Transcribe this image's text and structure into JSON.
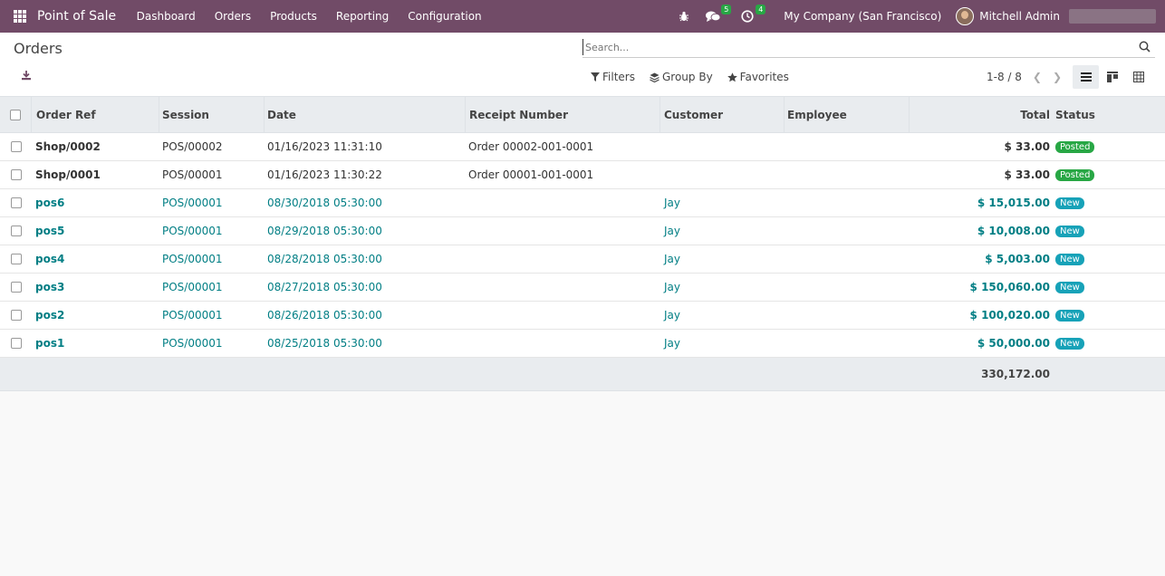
{
  "navbar": {
    "app_name": "Point of Sale",
    "menu": [
      "Dashboard",
      "Orders",
      "Products",
      "Reporting",
      "Configuration"
    ],
    "messages_count": "5",
    "activities_count": "4",
    "company": "My Company (San Francisco)",
    "user": "Mitchell Admin",
    "accent_color": "#714B67"
  },
  "control_panel": {
    "title": "Orders",
    "search_placeholder": "Search...",
    "filters_label": "Filters",
    "groupby_label": "Group By",
    "favorites_label": "Favorites",
    "pager": "1-8 / 8"
  },
  "table": {
    "headers": {
      "order_ref": "Order Ref",
      "session": "Session",
      "date": "Date",
      "receipt": "Receipt Number",
      "customer": "Customer",
      "employee": "Employee",
      "total": "Total",
      "status": "Status"
    },
    "rows": [
      {
        "ref": "Shop/0002",
        "session": "POS/00002",
        "date": "01/16/2023 11:31:10",
        "receipt": "Order 00002-001-0001",
        "customer": "",
        "employee": "",
        "total": "$ 33.00",
        "status": "Posted"
      },
      {
        "ref": "Shop/0001",
        "session": "POS/00001",
        "date": "01/16/2023 11:30:22",
        "receipt": "Order 00001-001-0001",
        "customer": "",
        "employee": "",
        "total": "$ 33.00",
        "status": "Posted"
      },
      {
        "ref": "pos6",
        "session": "POS/00001",
        "date": "08/30/2018 05:30:00",
        "receipt": "",
        "customer": "Jay",
        "employee": "",
        "total": "$ 15,015.00",
        "status": "New"
      },
      {
        "ref": "pos5",
        "session": "POS/00001",
        "date": "08/29/2018 05:30:00",
        "receipt": "",
        "customer": "Jay",
        "employee": "",
        "total": "$ 10,008.00",
        "status": "New"
      },
      {
        "ref": "pos4",
        "session": "POS/00001",
        "date": "08/28/2018 05:30:00",
        "receipt": "",
        "customer": "Jay",
        "employee": "",
        "total": "$ 5,003.00",
        "status": "New"
      },
      {
        "ref": "pos3",
        "session": "POS/00001",
        "date": "08/27/2018 05:30:00",
        "receipt": "",
        "customer": "Jay",
        "employee": "",
        "total": "$ 150,060.00",
        "status": "New"
      },
      {
        "ref": "pos2",
        "session": "POS/00001",
        "date": "08/26/2018 05:30:00",
        "receipt": "",
        "customer": "Jay",
        "employee": "",
        "total": "$ 100,020.00",
        "status": "New"
      },
      {
        "ref": "pos1",
        "session": "POS/00001",
        "date": "08/25/2018 05:30:00",
        "receipt": "",
        "customer": "Jay",
        "employee": "",
        "total": "$ 50,000.00",
        "status": "New"
      }
    ],
    "sum_total": "330,172.00"
  }
}
